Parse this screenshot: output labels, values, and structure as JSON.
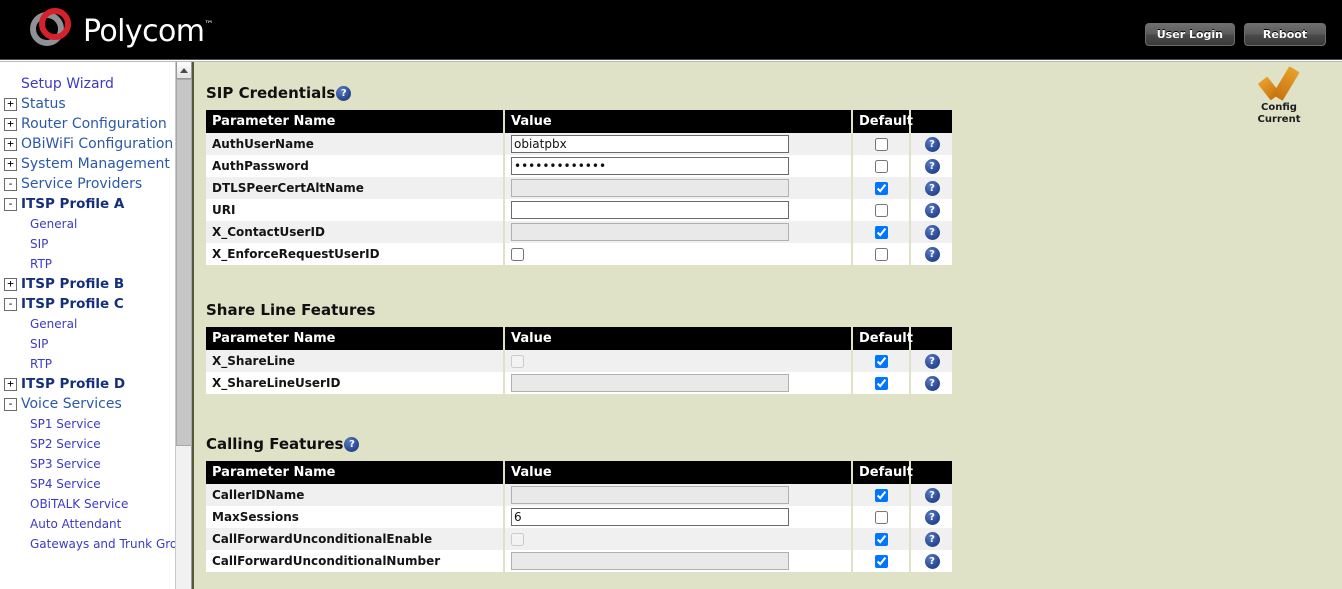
{
  "header": {
    "brand": "Polycom",
    "trademark": "™",
    "buttons": [
      {
        "label": "User Login",
        "name": "user-login-button"
      },
      {
        "label": "Reboot",
        "name": "reboot-button"
      }
    ]
  },
  "config_status": {
    "line1": "Config",
    "line2": "Current",
    "accent_color": "#d98a1c"
  },
  "sidebar": {
    "items": [
      {
        "label": "Setup Wizard",
        "toggle": "",
        "level": 0,
        "style": "wizard",
        "name": "sidebar-item-setup-wizard"
      },
      {
        "label": "Status",
        "toggle": "+",
        "level": 0,
        "style": "lvl0",
        "name": "sidebar-item-status"
      },
      {
        "label": "Router Configuration",
        "toggle": "+",
        "level": 0,
        "style": "lvl0",
        "name": "sidebar-item-router-configuration"
      },
      {
        "label": "OBiWiFi Configuration",
        "toggle": "+",
        "level": 0,
        "style": "lvl0",
        "name": "sidebar-item-obiwifi-configuration"
      },
      {
        "label": "System Management",
        "toggle": "+",
        "level": 0,
        "style": "lvl0",
        "name": "sidebar-item-system-management"
      },
      {
        "label": "Service Providers",
        "toggle": "-",
        "level": 0,
        "style": "lvl0",
        "name": "sidebar-item-service-providers"
      },
      {
        "label": "ITSP Profile A",
        "toggle": "-",
        "level": 0,
        "style": "profile",
        "name": "sidebar-item-itsp-profile-a"
      },
      {
        "label": "General",
        "toggle": "",
        "level": 2,
        "style": "sub",
        "name": "sidebar-item-profile-a-general"
      },
      {
        "label": "SIP",
        "toggle": "",
        "level": 2,
        "style": "sub",
        "name": "sidebar-item-profile-a-sip"
      },
      {
        "label": "RTP",
        "toggle": "",
        "level": 2,
        "style": "sub",
        "name": "sidebar-item-profile-a-rtp"
      },
      {
        "label": "ITSP Profile B",
        "toggle": "+",
        "level": 0,
        "style": "profile",
        "name": "sidebar-item-itsp-profile-b"
      },
      {
        "label": "ITSP Profile C",
        "toggle": "-",
        "level": 0,
        "style": "profile",
        "name": "sidebar-item-itsp-profile-c"
      },
      {
        "label": "General",
        "toggle": "",
        "level": 2,
        "style": "sub",
        "name": "sidebar-item-profile-c-general"
      },
      {
        "label": "SIP",
        "toggle": "",
        "level": 2,
        "style": "sub",
        "name": "sidebar-item-profile-c-sip"
      },
      {
        "label": "RTP",
        "toggle": "",
        "level": 2,
        "style": "sub",
        "name": "sidebar-item-profile-c-rtp"
      },
      {
        "label": "ITSP Profile D",
        "toggle": "+",
        "level": 0,
        "style": "profile",
        "name": "sidebar-item-itsp-profile-d"
      },
      {
        "label": "Voice Services",
        "toggle": "-",
        "level": 0,
        "style": "lvl0",
        "name": "sidebar-item-voice-services"
      },
      {
        "label": "SP1 Service",
        "toggle": "",
        "level": 2,
        "style": "sub",
        "name": "sidebar-item-sp1-service"
      },
      {
        "label": "SP2 Service",
        "toggle": "",
        "level": 2,
        "style": "sub",
        "name": "sidebar-item-sp2-service"
      },
      {
        "label": "SP3 Service",
        "toggle": "",
        "level": 2,
        "style": "sub",
        "name": "sidebar-item-sp3-service"
      },
      {
        "label": "SP4 Service",
        "toggle": "",
        "level": 2,
        "style": "sub",
        "name": "sidebar-item-sp4-service"
      },
      {
        "label": "OBiTALK Service",
        "toggle": "",
        "level": 2,
        "style": "sub",
        "name": "sidebar-item-obitalk-service"
      },
      {
        "label": "Auto Attendant",
        "toggle": "",
        "level": 2,
        "style": "sub",
        "name": "sidebar-item-auto-attendant"
      },
      {
        "label": "Gateways and Trunk Grou",
        "toggle": "",
        "level": 2,
        "style": "sub",
        "name": "sidebar-item-gateways-and-trunk-groups"
      }
    ]
  },
  "columns": {
    "name": "Parameter Name",
    "value": "Value",
    "default": "Default",
    "help": ""
  },
  "sections": [
    {
      "title": "SIP Credentials",
      "name": "section-sip-credentials",
      "has_help": true,
      "rows": [
        {
          "param": "AuthUserName",
          "type": "text",
          "value": "obiatpbx",
          "enabled": true,
          "default": false
        },
        {
          "param": "AuthPassword",
          "type": "password",
          "value": "•••••••••••••",
          "enabled": true,
          "default": false
        },
        {
          "param": "DTLSPeerCertAltName",
          "type": "text",
          "value": "",
          "enabled": false,
          "default": true
        },
        {
          "param": "URI",
          "type": "text",
          "value": "",
          "enabled": true,
          "default": false
        },
        {
          "param": "X_ContactUserID",
          "type": "text",
          "value": "",
          "enabled": false,
          "default": true
        },
        {
          "param": "X_EnforceRequestUserID",
          "type": "checkbox",
          "value": false,
          "enabled": true,
          "default": false
        }
      ]
    },
    {
      "title": "Share Line Features",
      "name": "section-share-line-features",
      "has_help": false,
      "rows": [
        {
          "param": "X_ShareLine",
          "type": "checkbox",
          "value": false,
          "enabled": false,
          "default": true
        },
        {
          "param": "X_ShareLineUserID",
          "type": "text",
          "value": "",
          "enabled": false,
          "default": true
        }
      ]
    },
    {
      "title": "Calling Features",
      "name": "section-calling-features",
      "has_help": true,
      "rows": [
        {
          "param": "CallerIDName",
          "type": "text",
          "value": "",
          "enabled": false,
          "default": true
        },
        {
          "param": "MaxSessions",
          "type": "text",
          "value": "6",
          "enabled": true,
          "default": false
        },
        {
          "param": "CallForwardUnconditionalEnable",
          "type": "checkbox",
          "value": false,
          "enabled": false,
          "default": true
        },
        {
          "param": "CallForwardUnconditionalNumber",
          "type": "text",
          "value": "",
          "enabled": false,
          "default": true
        }
      ]
    }
  ],
  "icons": {
    "help": "?",
    "expand": "+",
    "collapse": "-",
    "scroll_up": "scroll-up-arrow"
  }
}
